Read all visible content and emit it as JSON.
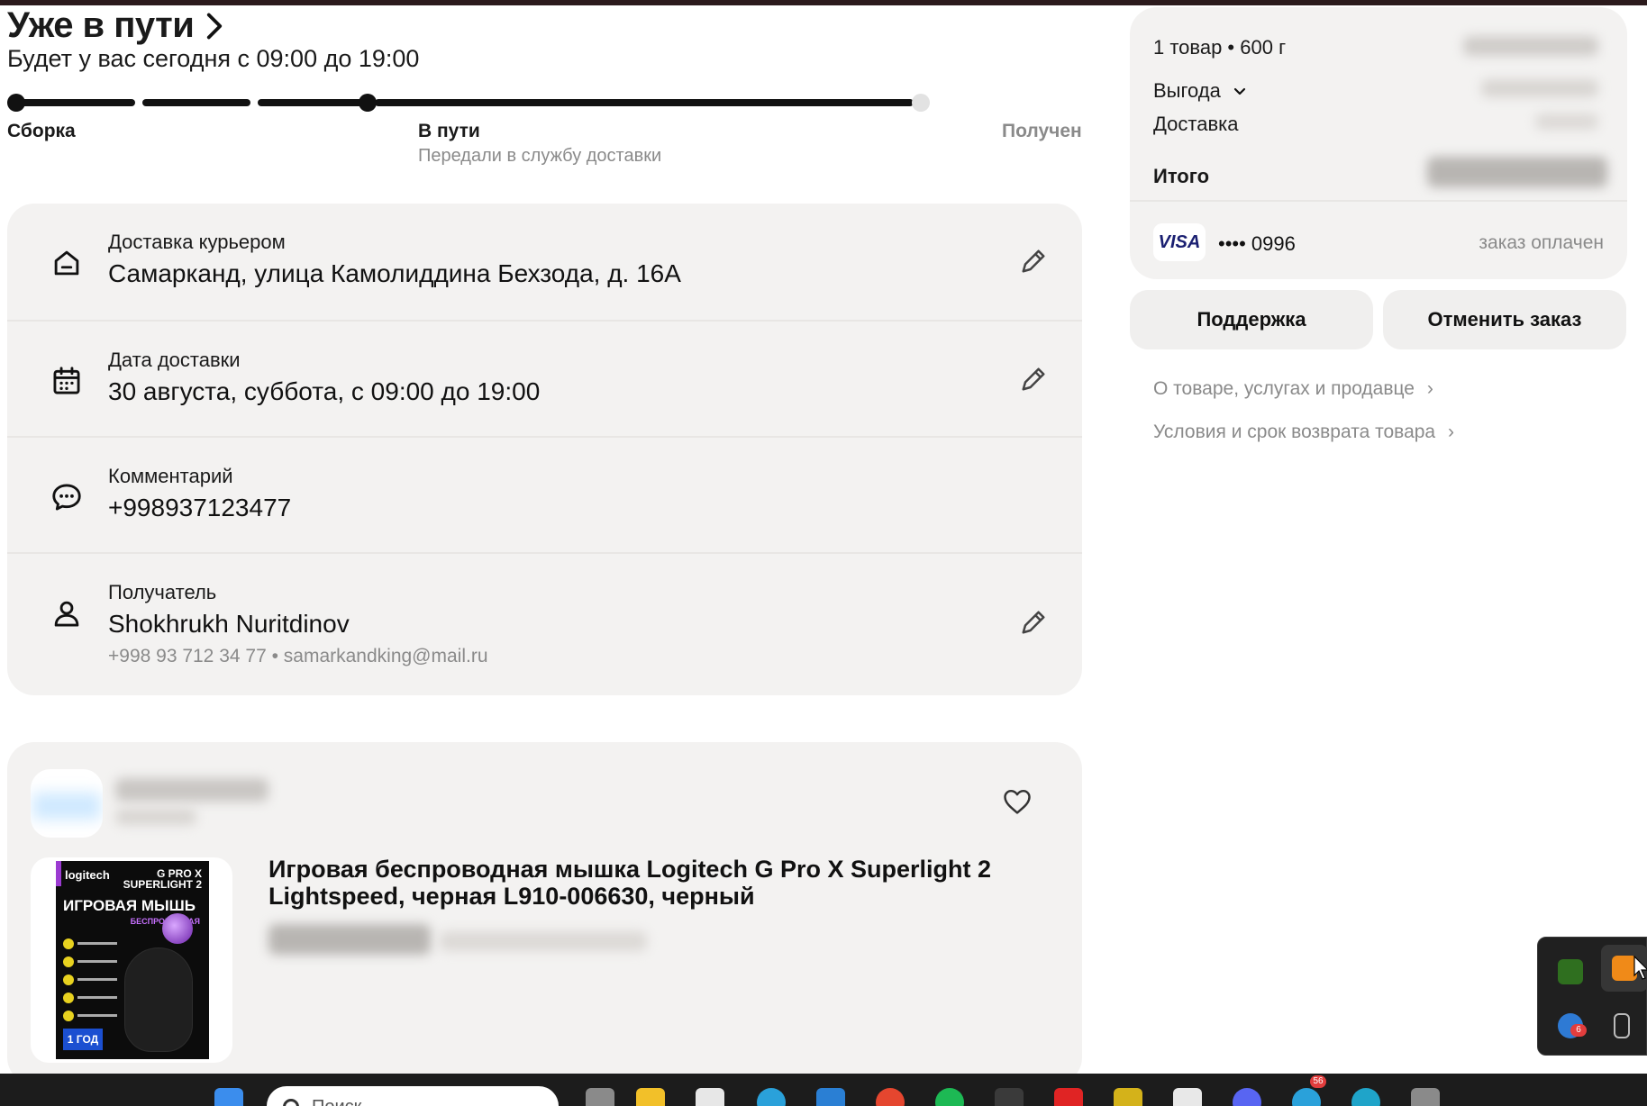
{
  "status": {
    "title": "Уже в пути",
    "subtitle": "Будет у вас сегодня с 09:00 до 19:00"
  },
  "progress": {
    "steps": [
      {
        "label": "Сборка",
        "sub": ""
      },
      {
        "label": "В пути",
        "sub": "Передали в службу доставки"
      },
      {
        "label": "Получен",
        "sub": ""
      }
    ],
    "current_step": 2
  },
  "delivery": {
    "address": {
      "label": "Доставка курьером",
      "value": "Самарканд, улица Камолиддина Бехзода, д. 16А"
    },
    "date": {
      "label": "Дата доставки",
      "value": "30 августа, суббота, с 09:00 до 19:00"
    },
    "comment": {
      "label": "Комментарий",
      "value": "+998937123477"
    },
    "recipient": {
      "label": "Получатель",
      "value": "Shokhrukh Nuritdinov",
      "contacts": "+998 93 712 34 77 • samarkandking@mail.ru"
    }
  },
  "product": {
    "title": "Игровая беспроводная мышка Logitech G Pro X Superlight 2 Lightspeed, черная L910-006630, черный",
    "box": {
      "brand": "logitech",
      "model_line1": "G PRO X",
      "model_line2": "SUPERLIGHT 2",
      "headline": "ИГРОВАЯ МЫШЬ",
      "sub": "БЕСПРОВОДНАЯ",
      "badge": "1 ГОД"
    }
  },
  "summary": {
    "items": "1 товар • 600 г",
    "benefit_label": "Выгода",
    "delivery_label": "Доставка",
    "total_label": "Итого",
    "card_brand": "VISA",
    "card_number": "•••• 0996",
    "payment_status": "заказ оплачен"
  },
  "actions": {
    "support": "Поддержка",
    "cancel": "Отменить заказ"
  },
  "links": {
    "product_info": "О товаре, услугах и продавце",
    "returns": "Условия и срок возврата товара"
  },
  "taskbar": {
    "search_placeholder": "Поиск",
    "badge_telegram": "56"
  },
  "tray": {
    "badge": "6"
  },
  "colors": {
    "card_bg": "#f3f2f1",
    "progress_active": "#111111",
    "progress_inactive": "#e2e2e2",
    "muted_text": "#8a8a8a"
  }
}
